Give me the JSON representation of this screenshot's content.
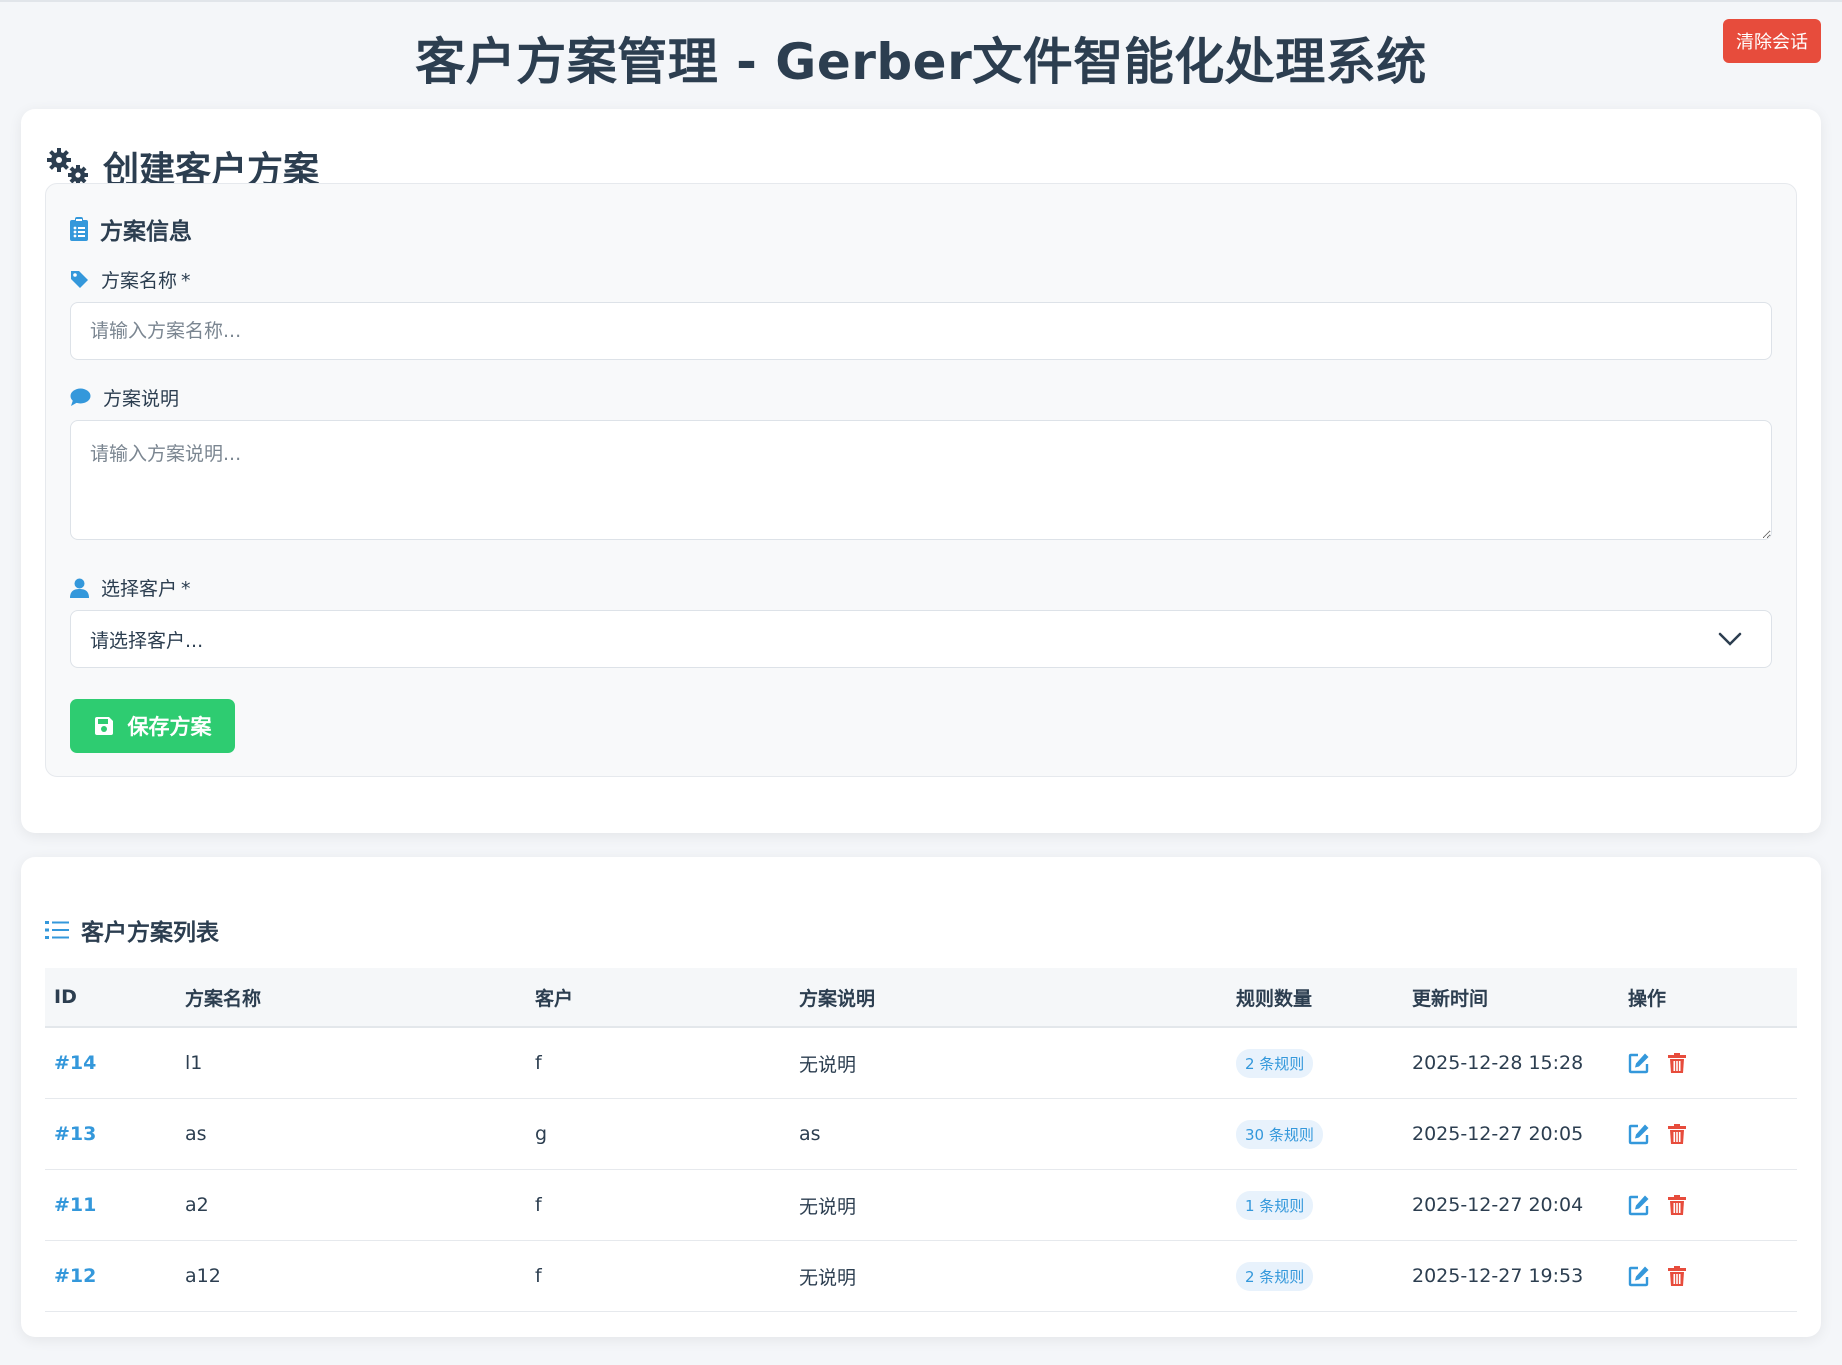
{
  "header": {
    "title": "客户方案管理 - Gerber文件智能化处理系统",
    "clear_session": "清除会话"
  },
  "create": {
    "heading": "创建客户方案",
    "section_title": "方案信息",
    "name_label": "方案名称",
    "required_mark": "*",
    "name_placeholder": "请输入方案名称...",
    "desc_label": "方案说明",
    "desc_placeholder": "请输入方案说明...",
    "customer_label": "选择客户",
    "customer_selected": "请选择客户...",
    "save_button": "保存方案"
  },
  "list": {
    "heading": "客户方案列表",
    "columns": [
      "ID",
      "方案名称",
      "客户",
      "方案说明",
      "规则数量",
      "更新时间",
      "操作"
    ],
    "rows": [
      {
        "id": "#14",
        "name": "l1",
        "customer": "f",
        "desc": "无说明",
        "rules": "2 条规则",
        "updated": "2025-12-28 15:28"
      },
      {
        "id": "#13",
        "name": "as",
        "customer": "g",
        "desc": "as",
        "rules": "30 条规则",
        "updated": "2025-12-27 20:05"
      },
      {
        "id": "#11",
        "name": "a2",
        "customer": "f",
        "desc": "无说明",
        "rules": "1 条规则",
        "updated": "2025-12-27 20:04"
      },
      {
        "id": "#12",
        "name": "a12",
        "customer": "f",
        "desc": "无说明",
        "rules": "2 条规则",
        "updated": "2025-12-27 19:53"
      }
    ]
  },
  "icons": {
    "heading": "gears-icon",
    "section": "clipboard-list-icon",
    "name_label": "tag-icon",
    "desc_label": "comment-icon",
    "customer_label": "user-icon",
    "select": "chevron-down-icon",
    "save": "save-icon",
    "list": "list-icon",
    "edit": "edit-icon",
    "delete": "trash-icon"
  },
  "colors": {
    "primary": "#3498db",
    "success": "#2ecc71",
    "danger": "#e74c3c",
    "text": "#2c3e50"
  }
}
